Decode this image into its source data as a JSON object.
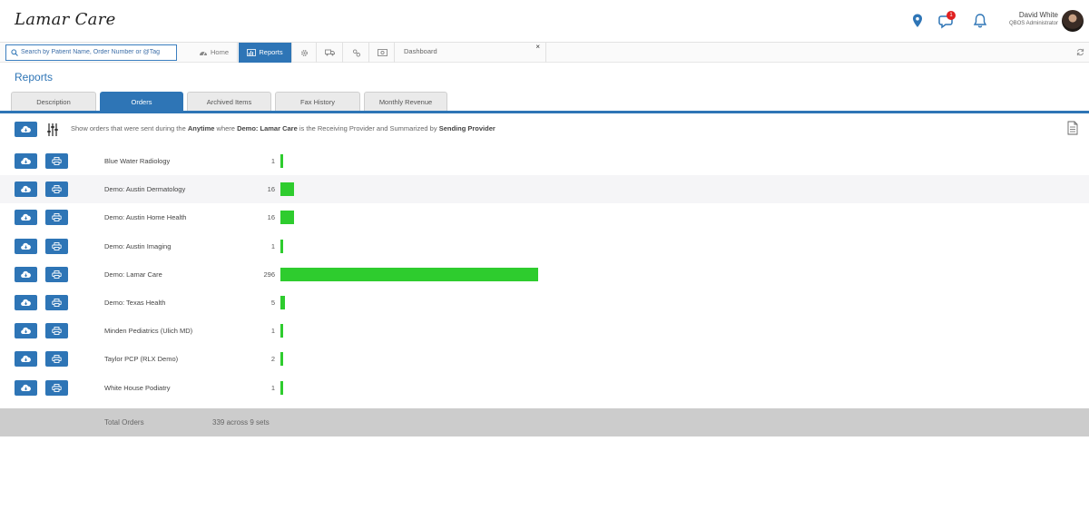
{
  "app": {
    "logo": "Lamar Care"
  },
  "header": {
    "notification_count": "1",
    "user_name": "David White",
    "user_role": "QBOS Administrator"
  },
  "toolbar": {
    "search_placeholder": "Search by Patient Name, Order Number or @Tag",
    "home_label": "Home",
    "reports_label": "Reports",
    "dashboard_label": "Dashboard",
    "close_glyph": "×"
  },
  "page": {
    "title": "Reports"
  },
  "tabs": [
    {
      "label": "Description"
    },
    {
      "label": "Orders"
    },
    {
      "label": "Archived Items"
    },
    {
      "label": "Fax History"
    },
    {
      "label": "Monthly Revenue"
    }
  ],
  "filter": {
    "prefix": "Show orders that were sent during the",
    "period": "Anytime",
    "mid1": "where",
    "provider": "Demo: Lamar Care",
    "mid2": "is the Receiving Provider and Summarized by",
    "summary": "Sending Provider"
  },
  "rows": [
    {
      "name": "Blue Water Radiology",
      "count": "1",
      "value": 1
    },
    {
      "name": "Demo: Austin Dermatology",
      "count": "16",
      "value": 16
    },
    {
      "name": "Demo: Austin Home Health",
      "count": "16",
      "value": 16
    },
    {
      "name": "Demo: Austin Imaging",
      "count": "1",
      "value": 1
    },
    {
      "name": "Demo: Lamar Care",
      "count": "296",
      "value": 296
    },
    {
      "name": "Demo: Texas Health",
      "count": "5",
      "value": 5
    },
    {
      "name": "Minden Pediatrics (Ulich MD)",
      "count": "1",
      "value": 1
    },
    {
      "name": "Taylor PCP (RLX Demo)",
      "count": "2",
      "value": 2
    },
    {
      "name": "White House Podiatry",
      "count": "1",
      "value": 1
    }
  ],
  "total": {
    "label": "Total Orders",
    "value": "339 across 9 sets"
  },
  "colors": {
    "accent": "#2e75b6",
    "bar": "#2ecc2e",
    "badge": "#e02020"
  }
}
